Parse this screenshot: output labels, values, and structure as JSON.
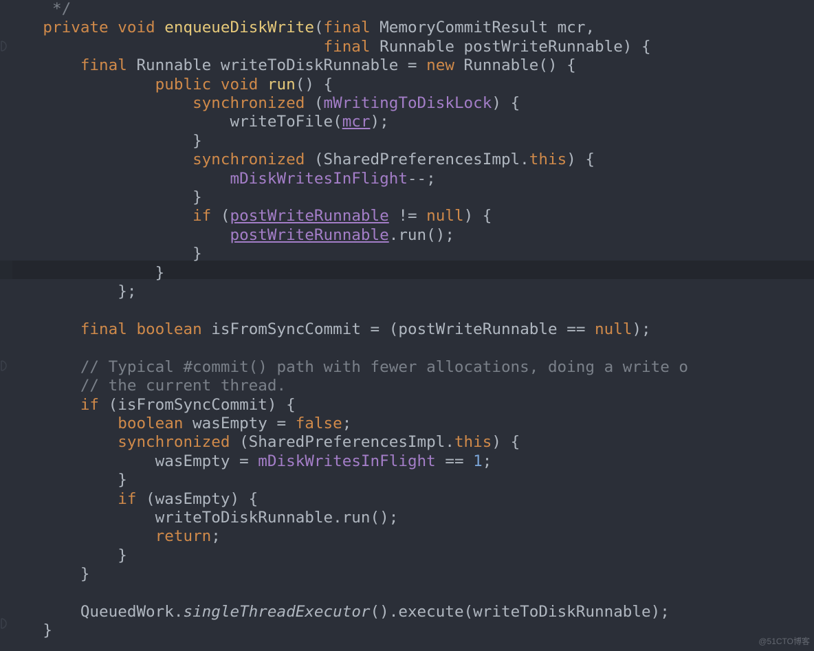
{
  "watermark": "@51CTO博客",
  "code": {
    "t": [
      "     */",
      "private",
      "void",
      "enqueueDiskWrite",
      "(",
      "final",
      " MemoryCommitResult ",
      "mcr",
      ",",
      "final",
      " Runnable ",
      "postWriteRunnable",
      ") {",
      "final",
      " Runnable ",
      "writeToDiskRunnable",
      " = ",
      "new",
      " Runnable() {",
      "public",
      "void",
      "run",
      "() {",
      "synchronized",
      " (",
      "mWritingToDiskLock",
      ") {",
      "writeToFile(",
      "mcr",
      ");",
      "}",
      "synchronized",
      " (SharedPreferencesImpl.",
      "this",
      ") {",
      "mDiskWritesInFlight",
      "--;",
      "}",
      "if",
      " (",
      "postWriteRunnable",
      " != ",
      "null",
      ") {",
      "postWriteRunnable",
      ".run();",
      "}",
      "}",
      "};",
      "final",
      "boolean",
      "isFromSyncCommit",
      " = (",
      "postWriteRunnable",
      " == ",
      "null",
      ");",
      "// Typical #commit() path with fewer allocations, doing a write o",
      "// the current thread.",
      "if",
      " (isFromSyncCommit) {",
      "boolean",
      " wasEmpty = ",
      "false",
      ";",
      "synchronized",
      " (SharedPreferencesImpl.",
      "this",
      ") {",
      "wasEmpty = ",
      "mDiskWritesInFlight",
      " == ",
      "1",
      ";",
      "}",
      "if",
      " (wasEmpty) {",
      "writeToDiskRunnable.run();",
      "return",
      ";",
      "}",
      "}",
      "QueuedWork.",
      "singleThreadExecutor",
      "().execute(writeToDiskRunnable);",
      "}"
    ]
  }
}
